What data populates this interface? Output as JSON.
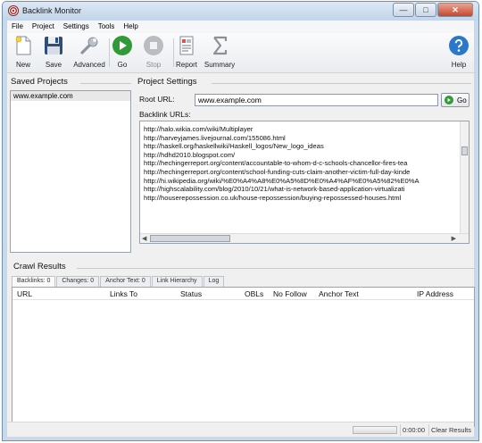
{
  "window": {
    "title": "Backlink Monitor"
  },
  "menu": [
    "File",
    "Project",
    "Settings",
    "Tools",
    "Help"
  ],
  "toolbar": {
    "new": "New",
    "save": "Save",
    "advanced": "Advanced",
    "go": "Go",
    "stop": "Stop",
    "report": "Report",
    "summary": "Summary",
    "help": "Help"
  },
  "saved_projects": {
    "label": "Saved Projects",
    "items": [
      "www.example.com"
    ]
  },
  "project_settings": {
    "label": "Project Settings",
    "root_url_label": "Root URL:",
    "root_url_value": "www.example.com",
    "go_label": "Go",
    "backlink_urls_label": "Backlink URLs:",
    "urls": [
      "http://halo.wikia.com/wiki/Multiplayer",
      "http://harveyjames.livejournal.com/155086.html",
      "http://haskell.org/haskellwiki/Haskell_logos/New_logo_ideas",
      "http://hdhd2010.blogspot.com/",
      "http://hechingerreport.org/content/accountable-to-whom-d-c-schools-chancellor-fires-tea",
      "http://hechingerreport.org/content/school-funding-cuts-claim-another-victim-full-day-kinde",
      "http://hi.wikipedia.org/wiki/%E0%A4%A8%E0%A5%8D%E0%A4%AF%E0%A5%82%E0%A",
      "http://highscalability.com/blog/2010/10/21/what-is-network-based-application-virtualizati",
      "http://houserepossession.co.uk/house-repossession/buying-repossessed-houses.html"
    ]
  },
  "crawl_results": {
    "label": "Crawl Results",
    "tabs": [
      "Backlinks: 0",
      "Changes: 0",
      "Anchor Text: 0",
      "Link Hierarchy",
      "Log"
    ],
    "columns": [
      "URL",
      "Links To",
      "Status",
      "OBLs",
      "No Follow",
      "Anchor Text",
      "IP Address"
    ]
  },
  "statusbar": {
    "elapsed": "0:00:00",
    "clear_results": "Clear Results"
  },
  "colors": {
    "go_green": "#2f9a36",
    "help_blue": "#2a78c9",
    "title_bar": "#c9d9ec"
  }
}
